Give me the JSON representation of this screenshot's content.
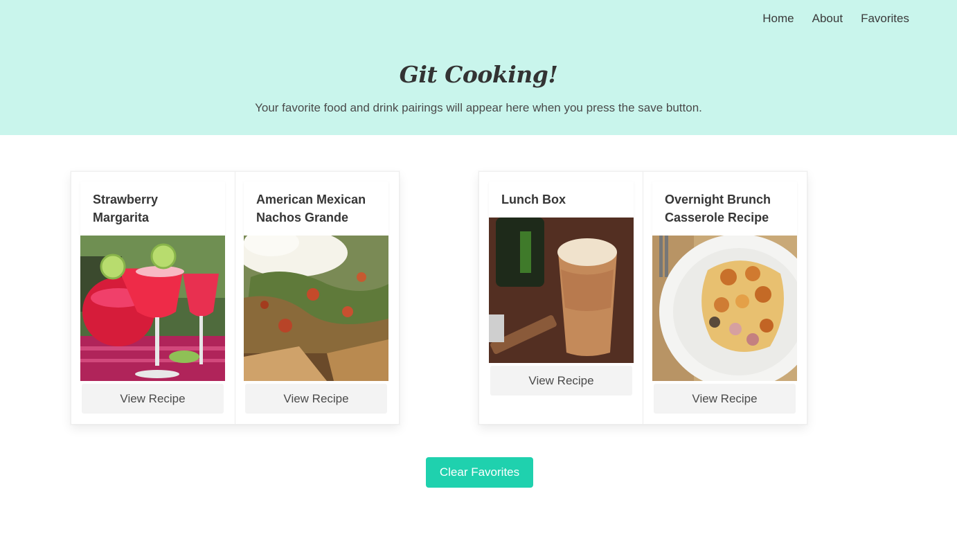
{
  "nav": {
    "items": [
      {
        "label": "Home"
      },
      {
        "label": "About"
      },
      {
        "label": "Favorites"
      }
    ]
  },
  "hero": {
    "title": "Git Cooking!",
    "subtitle": "Your favorite food and drink pairings will appear here when you press the save button."
  },
  "pairings": [
    {
      "drink": {
        "title": "Strawberry Margarita",
        "image": "strawberry-margarita-photo",
        "button": "View Recipe"
      },
      "food": {
        "title": "American Mexican Nachos Grande",
        "image": "nachos-photo",
        "button": "View Recipe"
      }
    },
    {
      "drink": {
        "title": "Lunch Box",
        "image": "beer-cocktail-photo",
        "button": "View Recipe"
      },
      "food": {
        "title": "Overnight Brunch Casserole Recipe",
        "image": "brunch-casserole-photo",
        "button": "View Recipe"
      }
    }
  ],
  "actions": {
    "clear_label": "Clear Favorites"
  },
  "colors": {
    "hero_background": "#c9f5ec",
    "primary_button": "#1fd1ae",
    "card_button": "#f3f3f3"
  }
}
